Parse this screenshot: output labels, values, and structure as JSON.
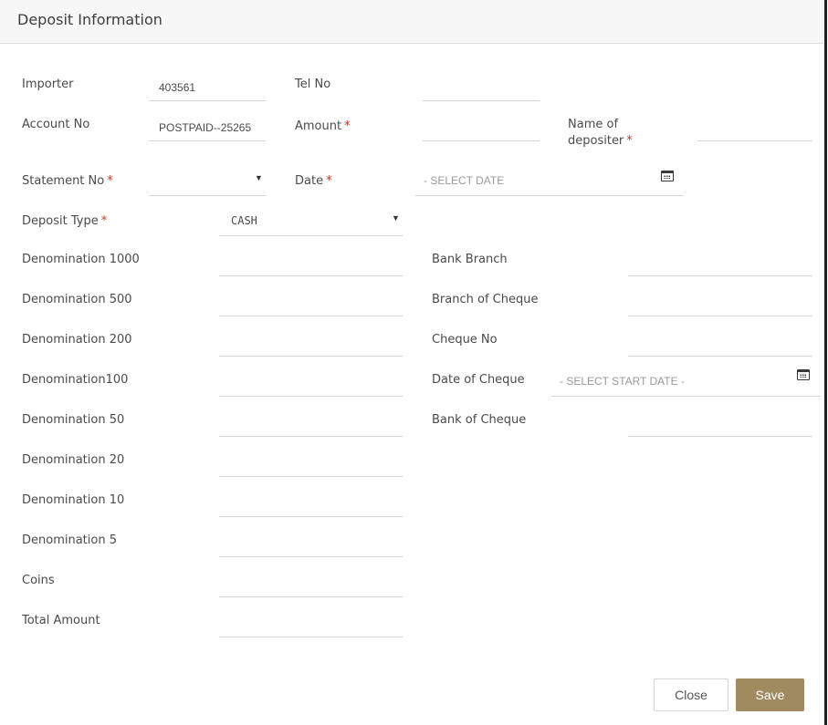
{
  "modal": {
    "title": "Deposit Information"
  },
  "form": {
    "importer": {
      "label": "Importer",
      "value": "403561"
    },
    "tel_no": {
      "label": "Tel No",
      "value": ""
    },
    "account_no": {
      "label": "Account No",
      "value": "POSTPAID--25265"
    },
    "amount": {
      "label": "Amount",
      "required": "*",
      "value": ""
    },
    "name_of_depositer": {
      "label_line1": "Name of",
      "label_line2": "depositer",
      "required": "*",
      "value": ""
    },
    "statement_no": {
      "label": "Statement No",
      "required": "*",
      "value": "",
      "caret": "▼"
    },
    "date": {
      "label": "Date",
      "required": "*",
      "placeholder": "- SELECT DATE"
    },
    "deposit_type": {
      "label": "Deposit Type",
      "required": "*",
      "value": "CASH",
      "caret": "▼"
    },
    "denominations": [
      {
        "label": "Denomination 1000",
        "value": ""
      },
      {
        "label": "Denomination 500",
        "value": ""
      },
      {
        "label": "Denomination 200",
        "value": ""
      },
      {
        "label": "Denomination100",
        "value": ""
      },
      {
        "label": "Denomination 50",
        "value": ""
      },
      {
        "label": "Denomination 20",
        "value": ""
      },
      {
        "label": "Denomination 10",
        "value": ""
      },
      {
        "label": "Denomination 5",
        "value": ""
      },
      {
        "label": "Coins",
        "value": ""
      },
      {
        "label": "Total Amount",
        "value": ""
      }
    ],
    "bank_branch": {
      "label": "Bank Branch",
      "value": ""
    },
    "branch_of_cheque": {
      "label": "Branch of Cheque",
      "value": ""
    },
    "cheque_no": {
      "label": "Cheque No",
      "value": ""
    },
    "date_of_cheque": {
      "label": "Date of Cheque",
      "placeholder": "- SELECT START DATE -"
    },
    "bank_of_cheque": {
      "label": "Bank of Cheque",
      "value": ""
    }
  },
  "icons": {
    "calendar": "calendar-icon",
    "dropdown": "chevron-down-icon"
  },
  "buttons": {
    "close": "Close",
    "save": "Save"
  },
  "colors": {
    "accent": "#a08a5f",
    "required": "#c0392b",
    "header_bg": "#f7f7f7"
  }
}
